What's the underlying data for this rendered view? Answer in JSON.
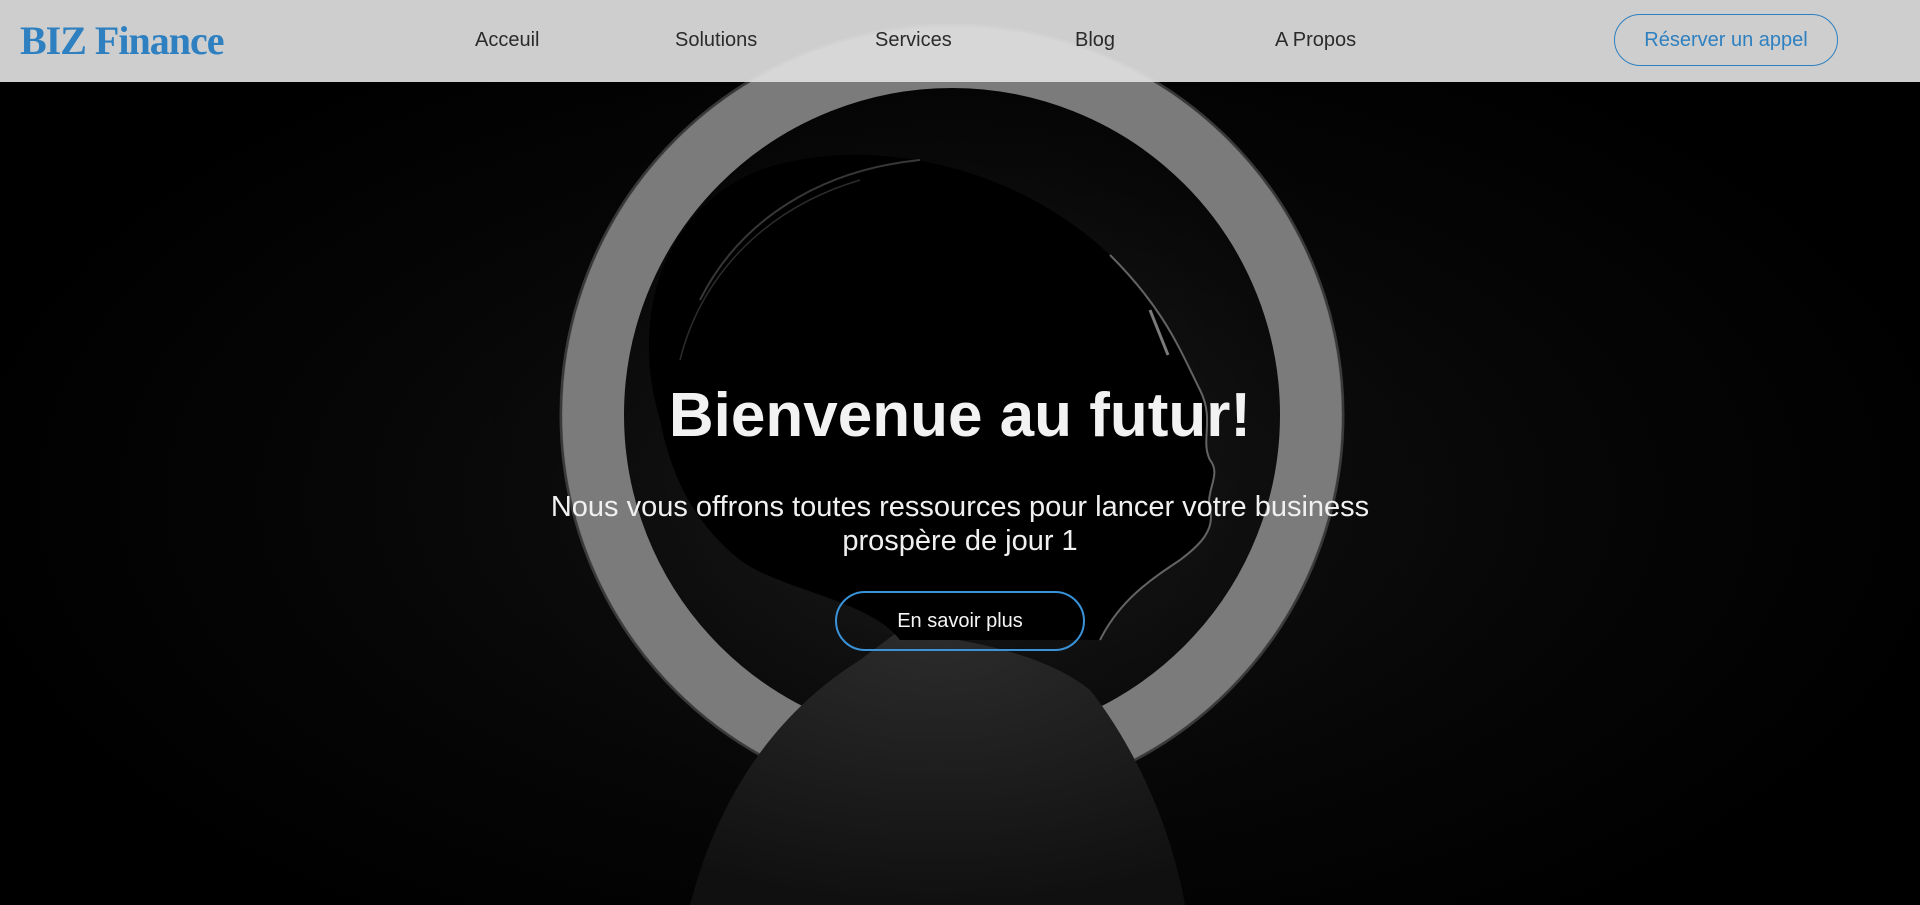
{
  "nav": {
    "brand": "BIZ Finance",
    "links": [
      "Acceuil",
      "Solutions",
      "Services",
      "Blog",
      "A Propos"
    ],
    "cta_label": "Réserver un appel"
  },
  "hero": {
    "title": "Bienvenue au futur!",
    "subtitle": "Nous vous offrons toutes ressources pour lancer votre business prospère de jour 1",
    "button_label": "En savoir plus",
    "image": "silhouette-profile-ring-light"
  },
  "colors": {
    "accent": "#2e80c0",
    "button_border": "#3a92d8",
    "nav_background": "#dedede",
    "hero_background": "#000000",
    "hero_text": "#f2f2f2"
  }
}
